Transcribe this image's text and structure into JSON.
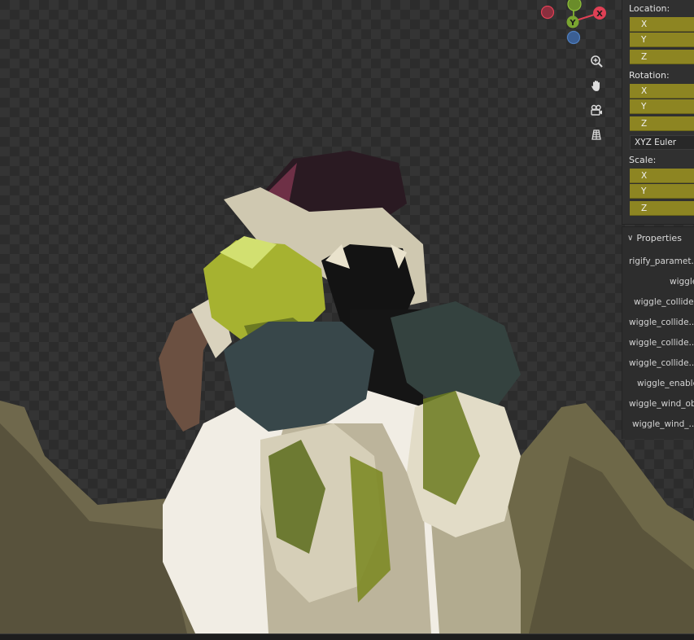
{
  "gizmo": {
    "x_label": "X",
    "y_label": "Y"
  },
  "nav_icons": [
    "zoom-icon",
    "hand-pan-icon",
    "camera-icon",
    "grid-icon"
  ],
  "n_panel": {
    "location": {
      "label": "Location:",
      "x": "X",
      "y": "Y",
      "z": "Z"
    },
    "rotation": {
      "label": "Rotation:",
      "x": "X",
      "y": "Y",
      "z": "Z",
      "mode": "XYZ Euler"
    },
    "scale": {
      "label": "Scale:",
      "x": "X",
      "y": "Y",
      "z": "Z"
    }
  },
  "properties": {
    "header": "Properties",
    "items": [
      "rigify_paramet...",
      "wiggle",
      "wiggle_collide...",
      "wiggle_collide...",
      "wiggle_collide...",
      "wiggle_collide...",
      "wiggle_enable",
      "wiggle_wind_ob",
      "wiggle_wind_..."
    ]
  },
  "colors": {
    "field_fill": "#8d8522",
    "panel_bg": "#303030",
    "axis_x": "#e04055",
    "axis_y": "#7aa530",
    "axis_z": "#4f7fc0"
  }
}
